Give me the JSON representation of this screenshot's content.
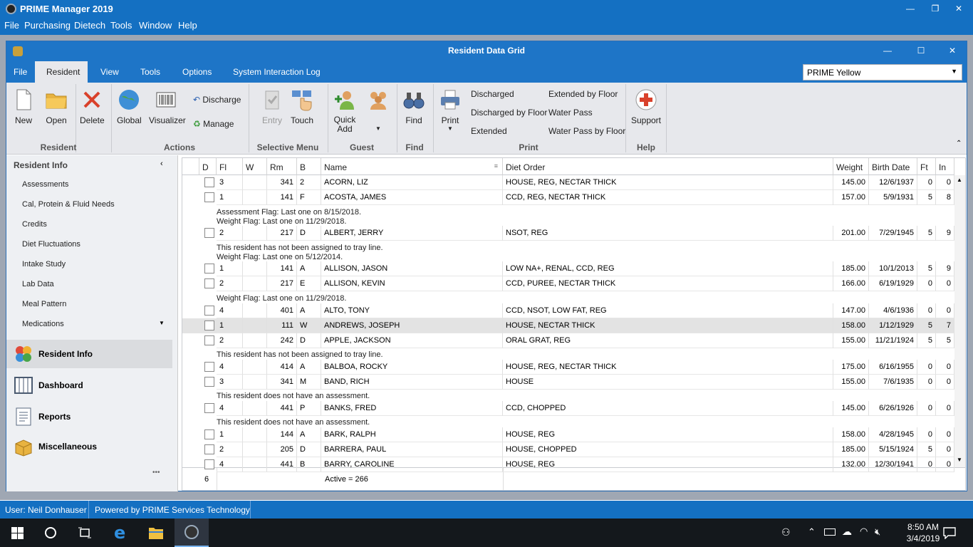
{
  "app": {
    "title": "PRIME Manager 2019",
    "menu": [
      "File",
      "Purchasing",
      "Dietech",
      "Tools",
      "Window",
      "Help"
    ],
    "win_min": "—",
    "win_restore": "❐",
    "win_close": "✕"
  },
  "window": {
    "title": "Resident Data Grid",
    "min": "—",
    "max": "☐",
    "close": "✕",
    "tabs": [
      "File",
      "Resident",
      "View",
      "Tools",
      "Options",
      "System Interaction Log"
    ],
    "theme": "PRIME Yellow"
  },
  "ribbon": {
    "new": "New",
    "open": "Open",
    "delete": "Delete",
    "global": "Global",
    "visualizer": "Visualizer",
    "discharge": "Discharge",
    "manage": "Manage",
    "entry": "Entry",
    "touch": "Touch",
    "quick_add": "Quick Add",
    "find": "Find",
    "print": "Print",
    "discharged": "Discharged",
    "discharged_by_floor": "Discharged by Floor",
    "extended": "Extended",
    "extended_by_floor": "Extended by Floor",
    "water_pass": "Water Pass",
    "water_pass_by_floor": "Water Pass by Floor",
    "support": "Support",
    "groups": {
      "resident": "Resident",
      "actions": "Actions",
      "selective_menu": "Selective Menu",
      "guest": "Guest",
      "find": "Find",
      "print": "Print",
      "help": "Help"
    }
  },
  "nav": {
    "header": "Resident Info",
    "items": [
      "Assessments",
      "Cal, Protein & Fluid Needs",
      "Credits",
      "Diet Fluctuations",
      "Intake Study",
      "Lab Data",
      "Meal Pattern",
      "Medications"
    ],
    "sections": [
      "Resident Info",
      "Dashboard",
      "Reports",
      "Miscellaneous"
    ],
    "more": "•••"
  },
  "grid": {
    "columns": [
      "D",
      "Fl",
      "W",
      "Rm",
      "B",
      "Name",
      "Diet Order",
      "Weight",
      "Birth Date",
      "Ft",
      "In"
    ],
    "rows": [
      {
        "fl": "3",
        "rm": "341",
        "b": "2",
        "name": "ACORN, LIZ",
        "diet": "HOUSE, REG, NECTAR THICK",
        "weight": "145.00",
        "birth": "12/6/1937",
        "ft": "0",
        "in": "0"
      },
      {
        "fl": "1",
        "rm": "141",
        "b": "F",
        "name": "ACOSTA, JAMES",
        "diet": "CCD, REG, NECTAR THICK",
        "weight": "157.00",
        "birth": "5/9/1931",
        "ft": "5",
        "in": "8"
      },
      {
        "fl": "2",
        "rm": "217",
        "b": "D",
        "name": "ALBERT, JERRY",
        "diet": "NSOT, REG",
        "weight": "201.00",
        "birth": "7/29/1945",
        "ft": "5",
        "in": "9"
      },
      {
        "fl": "1",
        "rm": "141",
        "b": "A",
        "name": "ALLISON, JASON",
        "diet": "LOW NA+, RENAL, CCD, REG",
        "weight": "185.00",
        "birth": "10/1/2013",
        "ft": "5",
        "in": "9"
      },
      {
        "fl": "2",
        "rm": "217",
        "b": "E",
        "name": "ALLISON, KEVIN",
        "diet": "CCD, PUREE, NECTAR THICK",
        "weight": "166.00",
        "birth": "6/19/1929",
        "ft": "0",
        "in": "0"
      },
      {
        "fl": "4",
        "rm": "401",
        "b": "A",
        "name": "ALTO, TONY",
        "diet": "CCD, NSOT, LOW FAT, REG",
        "weight": "147.00",
        "birth": "4/6/1936",
        "ft": "0",
        "in": "0"
      },
      {
        "fl": "1",
        "rm": "111",
        "b": "W",
        "name": "ANDREWS, JOSEPH",
        "diet": "HOUSE, NECTAR THICK",
        "weight": "158.00",
        "birth": "1/12/1929",
        "ft": "5",
        "in": "7"
      },
      {
        "fl": "2",
        "rm": "242",
        "b": "D",
        "name": "APPLE, JACKSON",
        "diet": "ORAL GRAT, REG",
        "weight": "155.00",
        "birth": "11/21/1924",
        "ft": "5",
        "in": "5"
      },
      {
        "fl": "4",
        "rm": "414",
        "b": "A",
        "name": "BALBOA, ROCKY",
        "diet": "HOUSE, REG, NECTAR THICK",
        "weight": "175.00",
        "birth": "6/16/1955",
        "ft": "0",
        "in": "0"
      },
      {
        "fl": "3",
        "rm": "341",
        "b": "M",
        "name": "BAND, RICH",
        "diet": "HOUSE",
        "weight": "155.00",
        "birth": "7/6/1935",
        "ft": "0",
        "in": "0"
      },
      {
        "fl": "4",
        "rm": "441",
        "b": "P",
        "name": "BANKS, FRED",
        "diet": "CCD, CHOPPED",
        "weight": "145.00",
        "birth": "6/26/1926",
        "ft": "0",
        "in": "0"
      },
      {
        "fl": "1",
        "rm": "144",
        "b": "A",
        "name": "BARK, RALPH",
        "diet": "HOUSE, REG",
        "weight": "158.00",
        "birth": "4/28/1945",
        "ft": "0",
        "in": "0"
      },
      {
        "fl": "2",
        "rm": "205",
        "b": "D",
        "name": "BARRERA, PAUL",
        "diet": "HOUSE, CHOPPED",
        "weight": "185.00",
        "birth": "5/15/1924",
        "ft": "5",
        "in": "0"
      },
      {
        "fl": "4",
        "rm": "441",
        "b": "B",
        "name": "BARRY, CAROLINE",
        "diet": "HOUSE, REG",
        "weight": "132.00",
        "birth": "12/30/1941",
        "ft": "0",
        "in": "0"
      }
    ],
    "notes": {
      "n1a": "Assessment Flag: Last one on 8/15/2018.",
      "n1b": "Weight Flag: Last one on 11/29/2018.",
      "n2a": "This resident has not been assigned to tray line.",
      "n2b": "Weight Flag: Last one on 5/12/2014.",
      "n3": "Weight Flag: Last one on 11/29/2018.",
      "n4": "This resident has not been assigned to tray line.",
      "n5": "This resident does not have an assessment.",
      "n6": "This resident does not have an assessment."
    },
    "footer_count": "6",
    "footer_active": "Active = 266",
    "current_row_indicator": "→"
  },
  "status": {
    "user": "User: Neil Donhauser",
    "powered": "Powered by PRIME Services Technology"
  },
  "taskbar": {
    "time": "8:50 AM",
    "date": "3/4/2019"
  },
  "colors": {
    "titlebar": "#1470c2",
    "ribbon": "#e7e8ec",
    "selected_row": "#e3e3e3"
  }
}
